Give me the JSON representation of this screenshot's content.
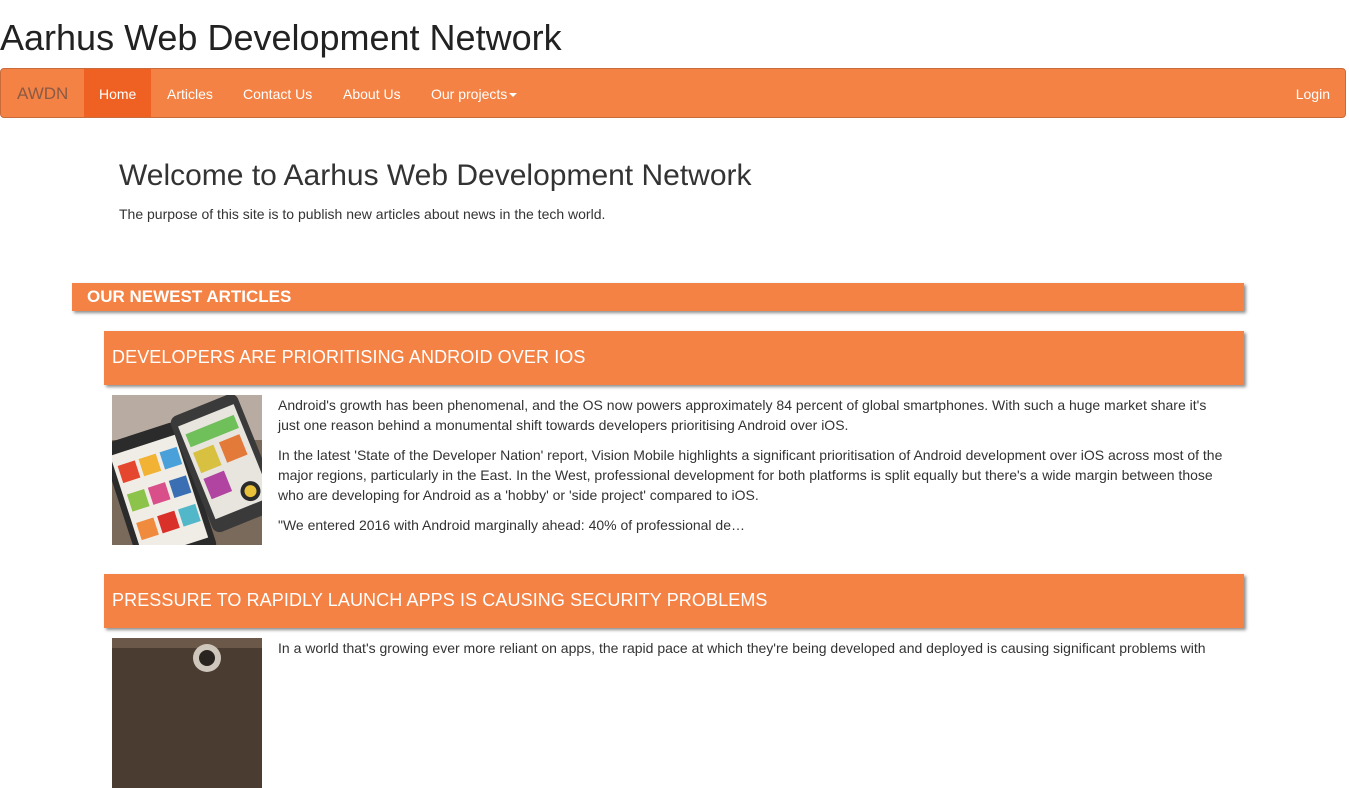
{
  "site": {
    "title": "Aarhus Web Development Network"
  },
  "navbar": {
    "brand": "AWDN",
    "items": [
      {
        "label": "Home"
      },
      {
        "label": "Articles"
      },
      {
        "label": "Contact Us"
      },
      {
        "label": "About Us"
      },
      {
        "label": "Our projects"
      }
    ],
    "login": "Login"
  },
  "welcome": {
    "title": "Welcome to Aarhus Web Development Network",
    "text": "The purpose of this site is to publish new articles about news in the tech world."
  },
  "newest": {
    "header": "OUR NEWEST ARTICLES",
    "articles": [
      {
        "title": "DEVELOPERS ARE PRIORITISING ANDROID OVER IOS",
        "paragraphs": [
          "Android's growth has been phenomenal, and the OS now powers approximately 84 percent of global smartphones. With such a huge market share it's just one reason behind a monumental shift towards developers prioritising Android over iOS.",
          "In the latest 'State of the Developer Nation' report, Vision Mobile highlights a significant prioritisation of Android development over iOS across most of the major regions, particularly in the East. In the West, professional development for both platforms is split equally but there's a wide margin between those who are developing for Android as a 'hobby' or 'side project' compared to iOS.",
          "\"We entered 2016 with Android marginally ahead: 40% of professional de…"
        ],
        "image": "android-phones-photo"
      },
      {
        "title": "PRESSURE TO RAPIDLY LAUNCH APPS IS CAUSING SECURITY PROBLEMS",
        "paragraphs": [
          "In a world that's growing ever more reliant on apps, the rapid pace at which they're being developed and deployed is causing significant problems with"
        ],
        "image": "security-photo"
      }
    ]
  },
  "colors": {
    "accent": "#f48245",
    "active": "#ef6122"
  }
}
